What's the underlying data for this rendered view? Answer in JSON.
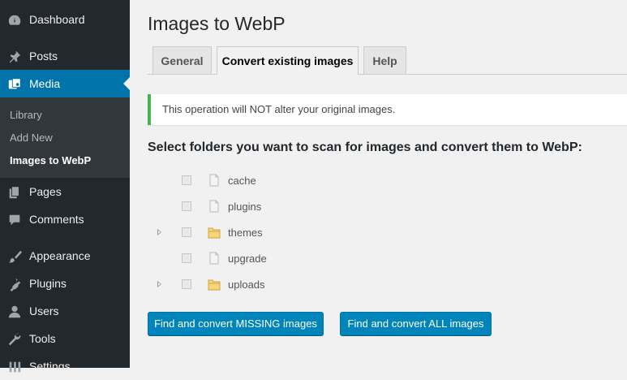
{
  "sidebar": {
    "menu": [
      {
        "label": "Dashboard",
        "icon": "dashboard-icon"
      },
      {
        "label": "Posts",
        "icon": "pushpin-icon"
      },
      {
        "label": "Media",
        "icon": "media-icon"
      },
      {
        "label": "Pages",
        "icon": "pages-icon"
      },
      {
        "label": "Comments",
        "icon": "comments-icon"
      },
      {
        "label": "Appearance",
        "icon": "paintbrush-icon"
      },
      {
        "label": "Plugins",
        "icon": "plugin-icon"
      },
      {
        "label": "Users",
        "icon": "user-icon"
      },
      {
        "label": "Tools",
        "icon": "wrench-icon"
      },
      {
        "label": "Settings",
        "icon": "settings-icon"
      }
    ],
    "submenu": [
      {
        "label": "Library"
      },
      {
        "label": "Add New"
      },
      {
        "label": "Images to WebP"
      }
    ]
  },
  "page": {
    "title": "Images to WebP",
    "tabs": [
      {
        "label": "General"
      },
      {
        "label": "Convert existing images"
      },
      {
        "label": "Help"
      }
    ],
    "notice": "This operation will NOT alter your original images.",
    "section_title": "Select folders you want to scan for images and convert them to WebP:",
    "folders": [
      {
        "name": "cache",
        "expandable": false
      },
      {
        "name": "plugins",
        "expandable": false
      },
      {
        "name": "themes",
        "expandable": true
      },
      {
        "name": "upgrade",
        "expandable": false
      },
      {
        "name": "uploads",
        "expandable": true
      }
    ],
    "buttons": {
      "missing": "Find and convert MISSING images",
      "all": "Find and convert ALL images"
    }
  },
  "colors": {
    "sidebar_bg": "#23282d",
    "submenu_bg": "#32373c",
    "accent": "#0073aa",
    "button": "#0085ba",
    "notice_success": "#46b450"
  }
}
